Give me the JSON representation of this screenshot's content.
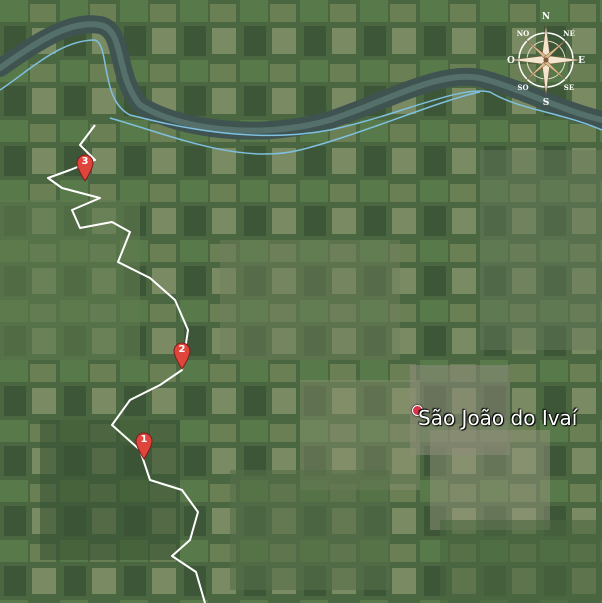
{
  "place": {
    "name": "São João do Ivaí"
  },
  "markers": [
    {
      "label": "1"
    },
    {
      "label": "2"
    },
    {
      "label": "3"
    }
  ],
  "compass": {
    "n": "N",
    "ne": "NE",
    "e": "E",
    "se": "SE",
    "s": "S",
    "so": "SO",
    "o": "O",
    "no": "NO"
  },
  "colors": {
    "route": "#ffffff",
    "boundary": "#7fc0e0",
    "marker": "#e0453c",
    "place_dot": "#d8334a"
  }
}
